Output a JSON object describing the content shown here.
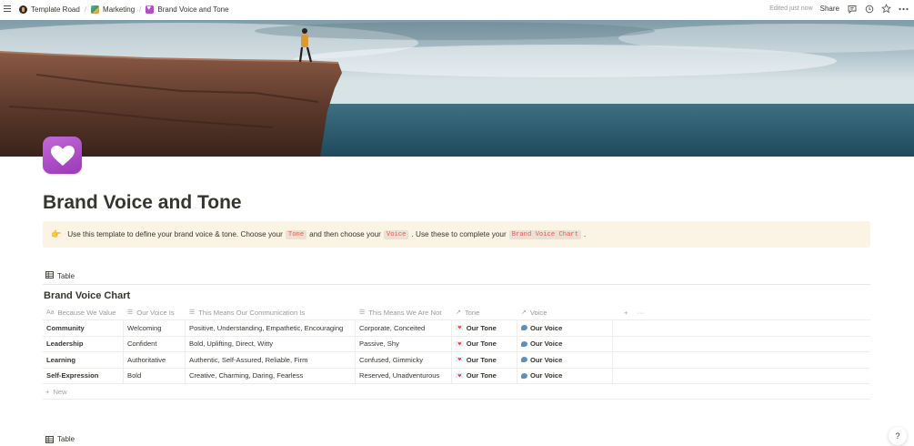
{
  "breadcrumb": {
    "items": [
      {
        "label": "Template Road",
        "icon": "template-road-icon"
      },
      {
        "label": "Marketing",
        "icon": "marketing-icon"
      },
      {
        "label": "Brand Voice and Tone",
        "icon": "purple-heart-icon"
      }
    ]
  },
  "topbar": {
    "edited": "Edited just now",
    "share": "Share"
  },
  "page": {
    "title": "Brand Voice and Tone",
    "icon": "purple-heart"
  },
  "callout": {
    "emoji": "👉",
    "text1": "Use this template to define your brand voice & tone. Choose your",
    "code1": "Tone",
    "text2": "and then choose your",
    "code2": "Voice",
    "text3": ". Use these to complete your",
    "code3": "Brand Voice Chart",
    "text4": "."
  },
  "view_tab": "Table",
  "database": {
    "title": "Brand Voice Chart",
    "columns": [
      {
        "label": "Because We Value",
        "icon": "Aa"
      },
      {
        "label": "Our Voice Is",
        "icon": "text-icon"
      },
      {
        "label": "This Means Our Communication Is",
        "icon": "text-icon"
      },
      {
        "label": "This Means We Are Not",
        "icon": "text-icon"
      },
      {
        "label": "Tone",
        "icon": "relation-arrow-icon"
      },
      {
        "label": "Voice",
        "icon": "relation-arrow-icon"
      }
    ],
    "rows": [
      {
        "value": "Community",
        "voice": "Welcoming",
        "means": "Positive, Understanding, Empathetic, Encouraging",
        "not": "Corporate, Conceited",
        "tone": "Our Tone",
        "voice_rel": "Our Voice"
      },
      {
        "value": "Leadership",
        "voice": "Confident",
        "means": "Bold, Uplifting, Direct, Witty",
        "not": "Passive, Shy",
        "tone": "Our Tone",
        "voice_rel": "Our Voice"
      },
      {
        "value": "Learning",
        "voice": "Authoritative",
        "means": "Authentic, Self-Assured, Reliable, Firm",
        "not": "Confused, Gimmicky",
        "tone": "Our Tone",
        "voice_rel": "Our Voice"
      },
      {
        "value": "Self-Expression",
        "voice": "Bold",
        "means": "Creative, Charming, Daring, Fearless",
        "not": "Reserved, Unadventurous",
        "tone": "Our Tone",
        "voice_rel": "Our Voice"
      }
    ],
    "new_label": "New",
    "add_symbol": "+",
    "more_symbol": "···"
  },
  "second_view_tab": "Table",
  "help": "?",
  "colors": {
    "callout_bg": "#fbf3e4",
    "code_red": "#eb5757",
    "icon_purple": "#a94cc4",
    "text": "#37352f",
    "muted": "#9b9a97"
  }
}
